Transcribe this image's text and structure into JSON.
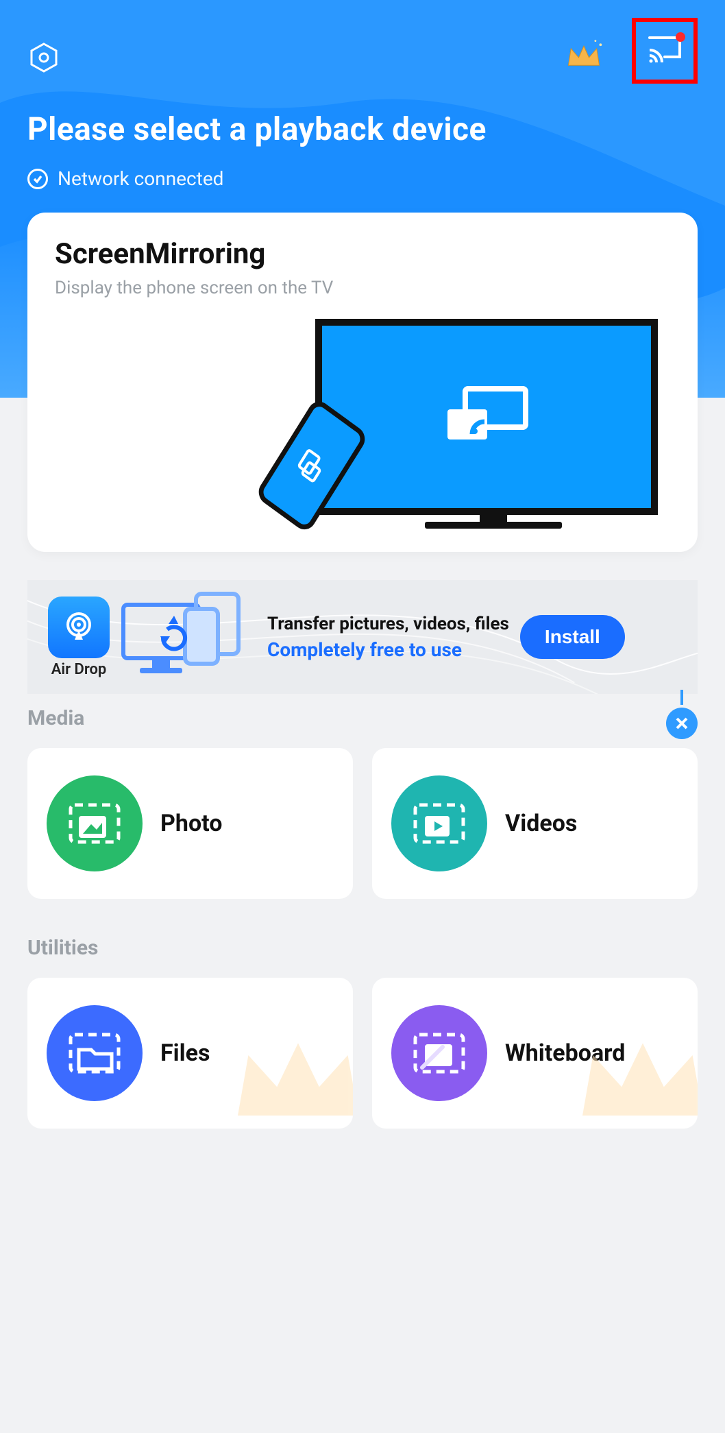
{
  "header": {
    "title": "Please select a playback device",
    "network_status": "Network connected"
  },
  "screen_mirroring": {
    "title": "ScreenMirroring",
    "subtitle": "Display the phone screen on the TV"
  },
  "promo": {
    "app_name": "Air Drop",
    "line1": "Transfer pictures, videos, files",
    "line2": "Completely free to use",
    "install_label": "Install"
  },
  "sections": {
    "media_label": "Media",
    "utilities_label": "Utilities"
  },
  "tiles": {
    "photo": "Photo",
    "videos": "Videos",
    "files": "Files",
    "whiteboard": "Whiteboard"
  },
  "icons": {
    "settings": "settings-icon",
    "crown": "crown-icon",
    "cast": "cast-icon",
    "close": "close-icon"
  },
  "colors": {
    "primary_blue": "#1a8dff",
    "accent_blue": "#1a6dff",
    "green": "#28bb6a",
    "teal": "#1fb5b0",
    "tile_blue": "#3c6bff",
    "purple": "#8a5cf0",
    "annotation_red": "#ff0000"
  }
}
